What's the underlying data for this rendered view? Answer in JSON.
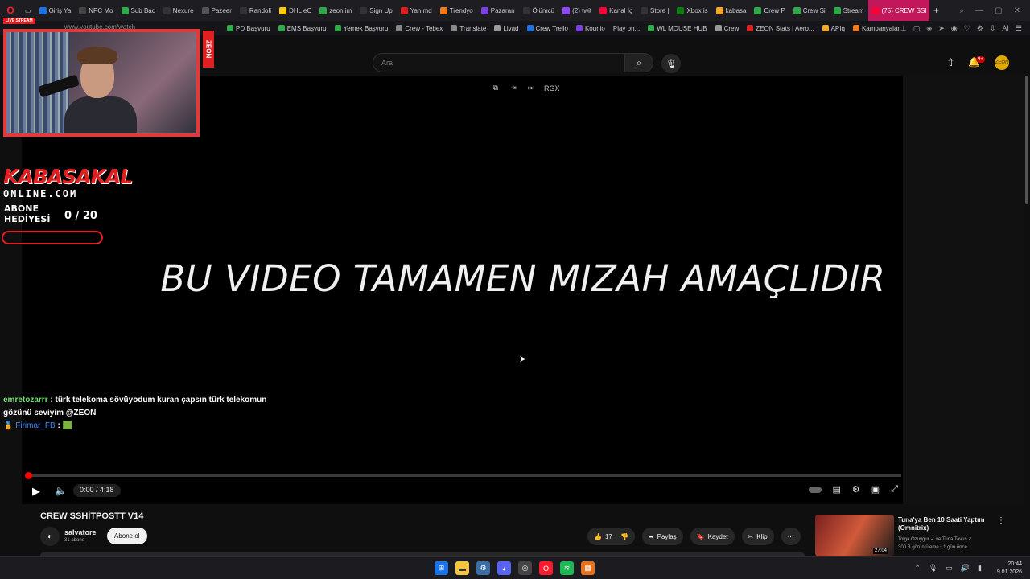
{
  "browser": {
    "url": "www.youtube.com/watch",
    "tabs": [
      {
        "label": "Giriş Ya",
        "color": "#1a73e8"
      },
      {
        "label": "NPC Mo",
        "color": "#444"
      },
      {
        "label": "Sub Bac",
        "color": "#2eaa4a"
      },
      {
        "label": "Nexure",
        "color": "#333"
      },
      {
        "label": "Pazeer",
        "color": "#555"
      },
      {
        "label": "Randoli",
        "color": "#333"
      },
      {
        "label": "DHL eC",
        "color": "#ffcc00"
      },
      {
        "label": "zeon im",
        "color": "#2eaa4a"
      },
      {
        "label": "Sign Up",
        "color": "#333"
      },
      {
        "label": "Yanımd",
        "color": "#e02020"
      },
      {
        "label": "Trendyo",
        "color": "#f27a1a"
      },
      {
        "label": "Pazaran",
        "color": "#7b3fe4"
      },
      {
        "label": "Ölümcü",
        "color": "#333"
      },
      {
        "label": "(2) twit",
        "color": "#9146ff"
      },
      {
        "label": "Kanal İç",
        "color": "#ff0033"
      },
      {
        "label": "Store |",
        "color": "#333"
      },
      {
        "label": "Xbox is",
        "color": "#107c10"
      },
      {
        "label": "kabasa",
        "color": "#f5a623"
      },
      {
        "label": "Crew P",
        "color": "#2eaa4a"
      },
      {
        "label": "Crew Şi",
        "color": "#2eaa4a"
      },
      {
        "label": "Stream",
        "color": "#2eaa4a"
      },
      {
        "label": "(75) CREW SSI",
        "color": "#ff0033",
        "active": true
      }
    ],
    "bookmarks": [
      "PD Başvuru",
      "EMS Başvuru",
      "Yemek Başvuru",
      "Crew - Tebex",
      "Translate",
      "Livad",
      "Crew Trello",
      "Kour.io",
      "Play on...",
      "WL MOUSE HUB",
      "Crew",
      "ZEON Stats | Aero...",
      "APIq",
      "Kampanyalar"
    ],
    "extras_label": "AI"
  },
  "youtube": {
    "search_placeholder": "Ara",
    "notif_count": "9+",
    "avatar_text": "ZEON"
  },
  "player": {
    "overlay_text": "BU VIDEO TAMAMEN MIZAH AMAÇLIDIR",
    "rgx": "RGX",
    "time": "0:00 / 4:18",
    "progress_fraction": 0
  },
  "stream_overlay": {
    "live_tag": "LIVE STREAM",
    "zeon_vertical": "ZEON",
    "logo": "KABASAKAL",
    "logo_sub": "ONLINE.COM",
    "abone_label": "ABONE HEDİYESİ",
    "count": "0  / 20",
    "chat": [
      {
        "user": "emretozarrr",
        "message": ": türk telekoma sövüyodum kuran çapsın türk telekomun gözünü seviyim @ZEON"
      },
      {
        "user": "Firimar_FB",
        "message": ":"
      }
    ]
  },
  "video": {
    "title": "CREW SSHİTPOSTT V14",
    "channel": "salvatore",
    "subscribers": "31 abone",
    "subscribe_label": "Abone ol",
    "likes": "17",
    "share_label": "Paylaş",
    "save_label": "Kaydet",
    "clip_label": "Klip"
  },
  "recommendation": {
    "title": "Tuna'ya Ben 10 Saati Yaptım (Omnitrix)",
    "channel": "Tolga Özuygur ✓ ve Tuna Tavus ✓",
    "meta": "300 B görüntüleme • 1 gün önce",
    "duration": "27:04"
  },
  "taskbar": {
    "time": "20:44",
    "date": "9.01.2026"
  }
}
